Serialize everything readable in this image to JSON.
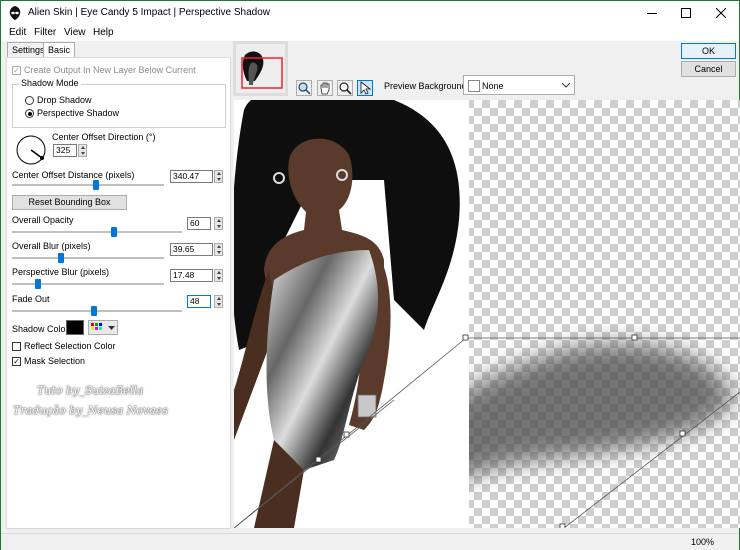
{
  "window": {
    "title": "Alien Skin | Eye Candy 5 Impact | Perspective Shadow"
  },
  "menu": [
    "Edit",
    "Filter",
    "View",
    "Help"
  ],
  "tabs": [
    "Settings",
    "Basic"
  ],
  "options": {
    "create_output": "Create Output In New Layer Below Current",
    "shadow_mode_label": "Shadow Mode",
    "drop_shadow": "Drop Shadow",
    "perspective_shadow": "Perspective Shadow",
    "selected_mode": "Perspective Shadow"
  },
  "center_offset_direction": {
    "label": "Center Offset Direction (°)",
    "value": "325"
  },
  "center_offset_distance": {
    "label": "Center Offset Distance (pixels)",
    "value": "340.47",
    "slider": 0.55
  },
  "reset_button": "Reset Bounding Box",
  "overall_opacity": {
    "label": "Overall Opacity",
    "value": "60",
    "slider": 0.6
  },
  "overall_blur": {
    "label": "Overall Blur (pixels)",
    "value": "39.65",
    "slider": 0.32
  },
  "perspective_blur": {
    "label": "Perspective Blur (pixels)",
    "value": "17.48",
    "slider": 0.17
  },
  "fade_out": {
    "label": "Fade Out",
    "value": "48",
    "slider": 0.48
  },
  "shadow_color": {
    "label": "Shadow Color",
    "swatch": "#000000"
  },
  "reflect_selection_color": {
    "label": "Reflect Selection Color",
    "checked": false
  },
  "mask_selection": {
    "label": "Mask Selection",
    "checked": true
  },
  "buttons": {
    "ok": "OK",
    "cancel": "Cancel"
  },
  "preview_background": {
    "label": "Preview Background:",
    "value": "None"
  },
  "watermark": {
    "line1": "Tuto by_SuizaBella",
    "line2": "Tradução by_Neusa Novaes"
  },
  "zoom": "100%"
}
